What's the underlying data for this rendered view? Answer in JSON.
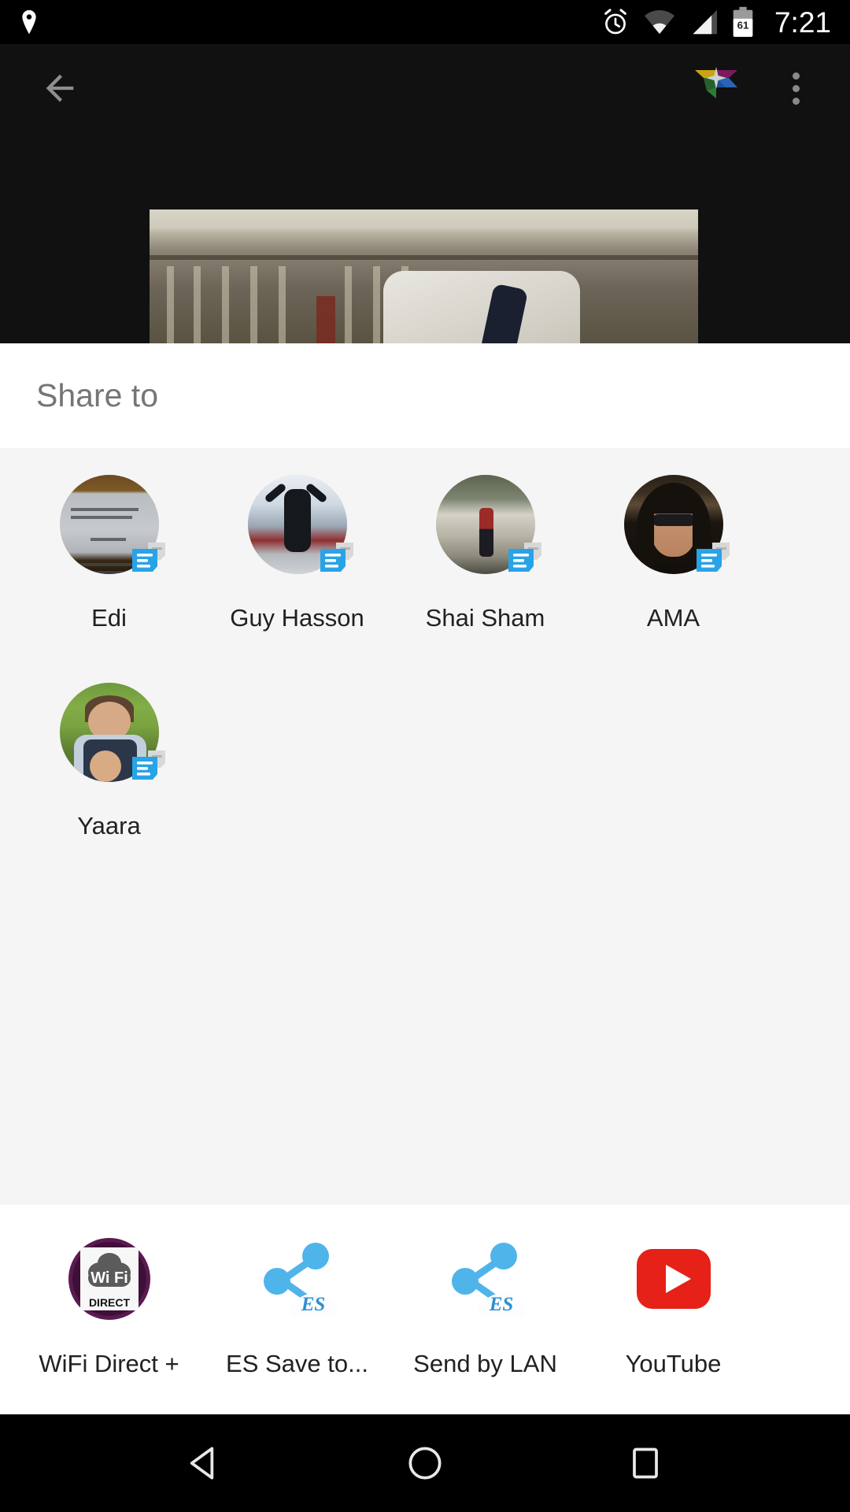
{
  "status_bar": {
    "time": "7:21",
    "battery_level": "61",
    "icons": [
      "location-icon",
      "alarm-icon",
      "wifi-icon",
      "cell-signal-icon",
      "battery-icon"
    ]
  },
  "app_bar": {
    "back_label": "back-arrow",
    "logo": "google-photos-logo",
    "overflow_label": "more-options"
  },
  "sheet": {
    "title": "Share to"
  },
  "direct_share": {
    "targets": [
      {
        "name": "Edi",
        "badge_app": "messages-icon",
        "avatar": "avatar-edi"
      },
      {
        "name": "Guy Hasson",
        "badge_app": "messages-icon",
        "avatar": "avatar-guy-hasson"
      },
      {
        "name": "Shai Sham",
        "badge_app": "messages-icon",
        "avatar": "avatar-shai-sham"
      },
      {
        "name": "AMA",
        "badge_app": "messages-icon",
        "avatar": "avatar-ama"
      },
      {
        "name": "Yaara",
        "badge_app": "messages-icon",
        "avatar": "avatar-yaara"
      }
    ]
  },
  "apps": {
    "items": [
      {
        "label": "WiFi Direct +",
        "icon": "wifi-direct-icon"
      },
      {
        "label": "ES Save to...",
        "icon": "es-share-icon"
      },
      {
        "label": "Send by LAN",
        "icon": "es-share-icon"
      },
      {
        "label": "YouTube",
        "icon": "youtube-icon"
      }
    ]
  },
  "nav_bar": {
    "back": "nav-back-icon",
    "home": "nav-home-icon",
    "recents": "nav-recents-icon"
  },
  "colors": {
    "sheet_bg": "#f5f5f5",
    "sheet_header_bg": "#ffffff",
    "title_text": "#757575",
    "label_text": "#212121",
    "badge_blue": "#29a3e8",
    "youtube_red": "#e62117",
    "wifi_direct_purple": "#5b1a50",
    "status_bg": "#000000"
  }
}
